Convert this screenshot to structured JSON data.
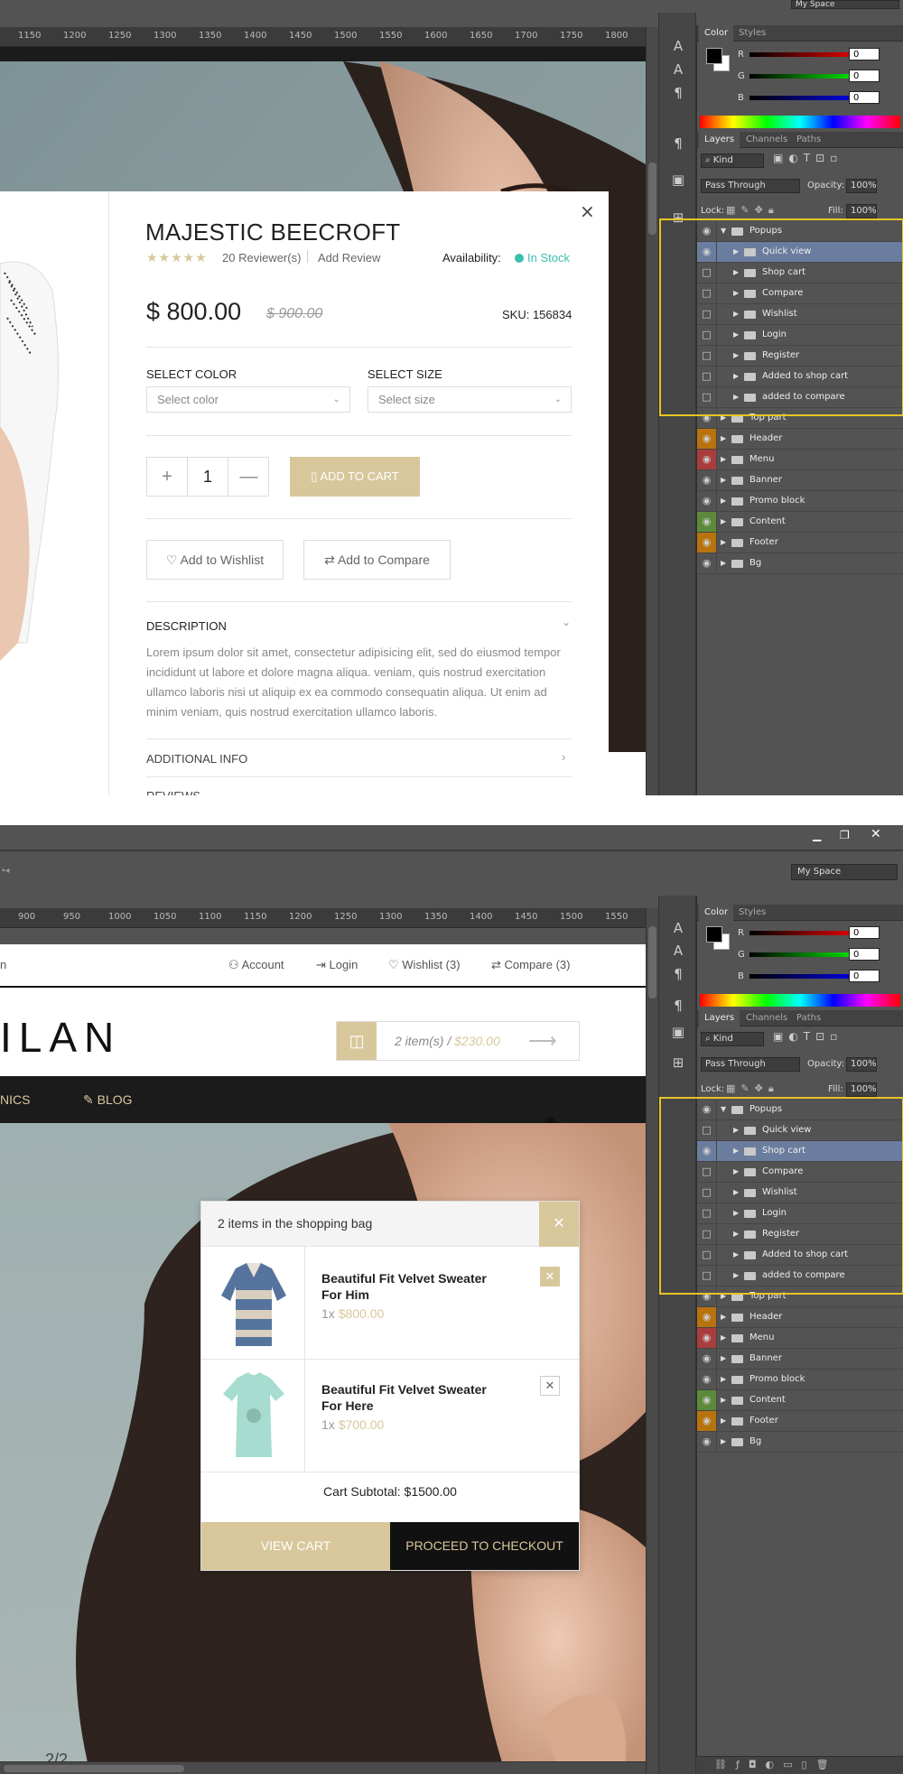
{
  "screenshot1": {
    "workspace": "My Space",
    "ruler_ticks": [
      "1150",
      "1200",
      "1250",
      "1300",
      "1350",
      "1400",
      "1450",
      "1500",
      "1550",
      "1600",
      "1650",
      "1700",
      "1750",
      "1800"
    ],
    "color_panel": {
      "tabs": [
        "Color",
        "Styles"
      ],
      "channels": [
        {
          "label": "R",
          "value": "0"
        },
        {
          "label": "G",
          "value": "0"
        },
        {
          "label": "B",
          "value": "0"
        }
      ]
    },
    "layers_panel": {
      "tabs": [
        "Layers",
        "Channels",
        "Paths"
      ],
      "kind": "Kind",
      "blend_mode": "Pass Through",
      "opacity_label": "Opacity:",
      "opacity": "100%",
      "lock_label": "Lock:",
      "fill_label": "Fill:",
      "fill": "100%",
      "layers": [
        {
          "name": "Popups",
          "indent": 0,
          "open": true,
          "eye": true,
          "color": ""
        },
        {
          "name": "Quick view",
          "indent": 1,
          "eye": true,
          "color": "",
          "selected": true
        },
        {
          "name": "Shop cart",
          "indent": 1,
          "eye": false,
          "color": ""
        },
        {
          "name": "Compare",
          "indent": 1,
          "eye": false,
          "color": ""
        },
        {
          "name": "Wishlist",
          "indent": 1,
          "eye": false,
          "color": ""
        },
        {
          "name": "Login",
          "indent": 1,
          "eye": false,
          "color": ""
        },
        {
          "name": "Register",
          "indent": 1,
          "eye": false,
          "color": ""
        },
        {
          "name": "Added to shop cart",
          "indent": 1,
          "eye": false,
          "color": ""
        },
        {
          "name": "added to compare",
          "indent": 1,
          "eye": false,
          "color": ""
        },
        {
          "name": "Top part",
          "indent": 0,
          "eye": true,
          "color": ""
        },
        {
          "name": "Header",
          "indent": 0,
          "eye": true,
          "color": "orange"
        },
        {
          "name": "Menu",
          "indent": 0,
          "eye": true,
          "color": "red"
        },
        {
          "name": "Banner",
          "indent": 0,
          "eye": true,
          "color": ""
        },
        {
          "name": "Promo block",
          "indent": 0,
          "eye": true,
          "color": ""
        },
        {
          "name": "Content",
          "indent": 0,
          "eye": true,
          "color": "green"
        },
        {
          "name": "Footer",
          "indent": 0,
          "eye": true,
          "color": "orange"
        },
        {
          "name": "Bg",
          "indent": 0,
          "eye": true,
          "color": ""
        }
      ]
    },
    "quick_view": {
      "title": "MAJESTIC BEECROFT",
      "reviews": "20 Reviewer(s)",
      "add_review": "Add Review",
      "availability_label": "Availability:",
      "availability": "In Stock",
      "price": "$ 800.00",
      "old_price": "$ 900.00",
      "sku": "SKU: 156834",
      "select_color_label": "SELECT COLOR",
      "select_color_placeholder": "Select color",
      "select_size_label": "SELECT SIZE",
      "select_size_placeholder": "Select size",
      "qty": "1",
      "add_to_cart": "ADD TO CART",
      "wishlist": "Add to Wishlist",
      "compare": "Add to Compare",
      "description_title": "DESCRIPTION",
      "description": "Lorem ipsum dolor sit amet, consectetur adipisicing elit, sed do eiusmod tempor incididunt ut labore et dolore magna aliqua. veniam, quis nostrud exercitation ullamco laboris nisi ut aliquip ex ea commodo consequatin aliqua. Ut enim ad minim veniam, quis nostrud exercitation ullamco laboris.",
      "additional_info": "ADDITIONAL INFO",
      "reviews_tab": "REVIEWS"
    }
  },
  "screenshot2": {
    "workspace": "My Space",
    "ruler_ticks": [
      "900",
      "950",
      "1000",
      "1050",
      "1100",
      "1150",
      "1200",
      "1250",
      "1300",
      "1350",
      "1400",
      "1450",
      "1500",
      "1550"
    ],
    "layers": [
      {
        "name": "Popups",
        "indent": 0,
        "open": true,
        "eye": true,
        "color": ""
      },
      {
        "name": "Quick view",
        "indent": 1,
        "eye": false,
        "color": ""
      },
      {
        "name": "Shop cart",
        "indent": 1,
        "eye": true,
        "color": "",
        "selected": true
      },
      {
        "name": "Compare",
        "indent": 1,
        "eye": false,
        "color": ""
      },
      {
        "name": "Wishlist",
        "indent": 1,
        "eye": false,
        "color": ""
      },
      {
        "name": "Login",
        "indent": 1,
        "eye": false,
        "color": ""
      },
      {
        "name": "Register",
        "indent": 1,
        "eye": false,
        "color": ""
      },
      {
        "name": "Added to shop cart",
        "indent": 1,
        "eye": false,
        "color": ""
      },
      {
        "name": "added to compare",
        "indent": 1,
        "eye": false,
        "color": ""
      },
      {
        "name": "Top part",
        "indent": 0,
        "eye": true,
        "color": ""
      },
      {
        "name": "Header",
        "indent": 0,
        "eye": true,
        "color": "orange"
      },
      {
        "name": "Menu",
        "indent": 0,
        "eye": true,
        "color": "red"
      },
      {
        "name": "Banner",
        "indent": 0,
        "eye": true,
        "color": ""
      },
      {
        "name": "Promo block",
        "indent": 0,
        "eye": true,
        "color": ""
      },
      {
        "name": "Content",
        "indent": 0,
        "eye": true,
        "color": "green"
      },
      {
        "name": "Footer",
        "indent": 0,
        "eye": true,
        "color": "orange"
      },
      {
        "name": "Bg",
        "indent": 0,
        "eye": true,
        "color": ""
      }
    ],
    "header": {
      "left_fragment": "n",
      "account": "Account",
      "login": "Login",
      "wishlist": "Wishlist (3)",
      "compare": "Compare (3)",
      "logo_fragment": "ILAN",
      "cart_items": "2 item(s) /",
      "cart_total": "$230.00",
      "nav_left": "NICS",
      "nav_blog": "BLOG"
    },
    "cart": {
      "heading": "2 items in the shopping bag",
      "items": [
        {
          "title": "Beautiful Fit Velvet Sweater For Him",
          "qty": "1x",
          "price": "$800.00"
        },
        {
          "title": "Beautiful Fit Velvet Sweater For Here",
          "qty": "1x",
          "price": "$700.00"
        }
      ],
      "subtotal": "Cart Subtotal: $1500.00",
      "view_cart": "VIEW CART",
      "checkout": "PROCEED TO CHECKOUT"
    },
    "page_number": "2/2"
  },
  "colors": {
    "gold": "#d8c79b",
    "dark": "#1b1b1b",
    "highlight": "#e6c523",
    "selected_layer": "#6b7d9e",
    "in_stock": "#3bbfad"
  }
}
